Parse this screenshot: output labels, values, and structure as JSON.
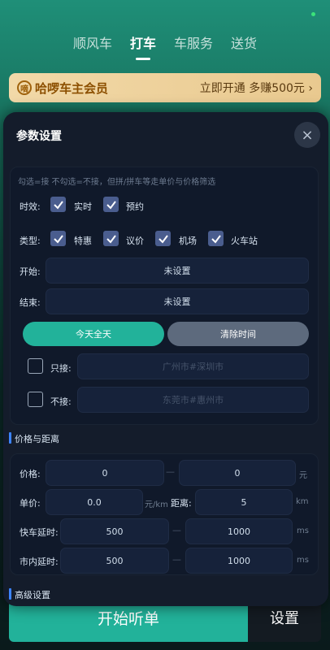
{
  "background": {
    "tabs": [
      {
        "label": "顺风车",
        "active": false
      },
      {
        "label": "打车",
        "active": true
      },
      {
        "label": "车服务",
        "active": false
      },
      {
        "label": "送货",
        "active": false
      }
    ],
    "member_banner": {
      "logo_char": "嘀",
      "title": "哈啰车主会员",
      "cta": "立即开通 多赚500元 ›"
    },
    "start_button": "开始听单",
    "settings_button": "设置"
  },
  "modal": {
    "title": "参数设置",
    "close_icon": "×",
    "hint": "勾选=接 不勾选=不接，但拼/拼车等走单价与价格筛选",
    "timing": {
      "label": "时效:",
      "options": [
        {
          "label": "实时",
          "checked": true
        },
        {
          "label": "预约",
          "checked": true
        }
      ]
    },
    "type": {
      "label": "类型:",
      "options": [
        {
          "label": "特惠",
          "checked": true
        },
        {
          "label": "议价",
          "checked": true
        },
        {
          "label": "机场",
          "checked": true
        },
        {
          "label": "火车站",
          "checked": true
        }
      ]
    },
    "start": {
      "label": "开始:",
      "value": "未设置"
    },
    "end": {
      "label": "结束:",
      "value": "未设置"
    },
    "all_day_button": "今天全天",
    "clear_time_button": "清除时间",
    "only_accept": {
      "label": "只接:",
      "placeholder": "广州市#深圳市",
      "checked": false
    },
    "not_accept": {
      "label": "不接:",
      "placeholder": "东莞市#惠州市",
      "checked": false
    },
    "price_section": {
      "title": "价格与距离",
      "price": {
        "label": "价格:",
        "min": "0",
        "max": "0",
        "unit": "元"
      },
      "unit_price": {
        "label": "单价:",
        "value": "0.0",
        "unit": "元/km"
      },
      "distance": {
        "label": "距离:",
        "value": "5",
        "unit": "km"
      },
      "express_delay": {
        "label": "快车延时:",
        "min": "500",
        "max": "1000",
        "unit": "ms"
      },
      "city_delay": {
        "label": "市内延时:",
        "min": "500",
        "max": "1000",
        "unit": "ms"
      },
      "dash": "—"
    },
    "advanced_section": {
      "title": "高级设置"
    }
  },
  "colors": {
    "accent_teal": "#22b29a",
    "checkbox_fill": "#4a5d8e",
    "panel_bg": "#141c2b"
  }
}
